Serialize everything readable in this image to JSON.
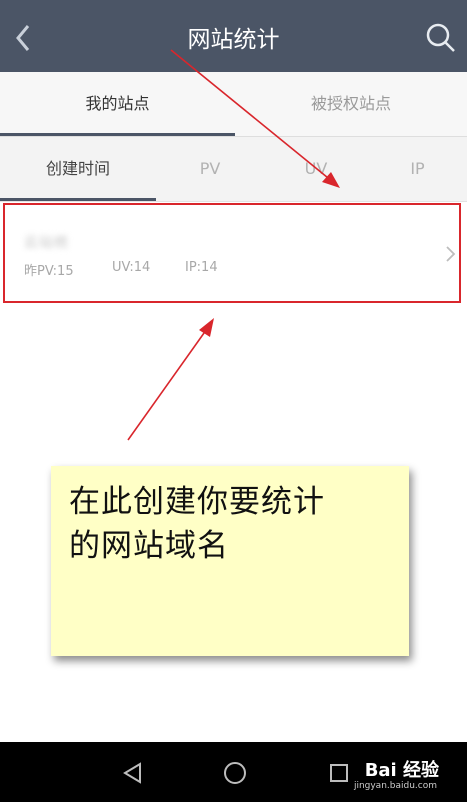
{
  "header": {
    "title": "网站统计",
    "back_icon": "chevron-left-icon",
    "search_icon": "search-icon"
  },
  "main_tabs": [
    {
      "label": "我的站点",
      "active": true
    },
    {
      "label": "被授权站点",
      "active": false
    }
  ],
  "sort_tabs": [
    {
      "label": "创建时间",
      "active": true
    },
    {
      "label": "PV",
      "active": false
    },
    {
      "label": "UV",
      "active": false
    },
    {
      "label": "IP",
      "active": false
    }
  ],
  "site": {
    "name": "云站统",
    "stats": [
      "昨PV:15",
      "UV:14",
      "IP:14"
    ]
  },
  "annotation": {
    "note_line1": "在此创建你要统计",
    "note_line2": "的网站域名"
  },
  "watermark": {
    "brand": "Bai 经验",
    "url": "jingyan.baidu.com"
  },
  "colors": {
    "header_bg": "#4b5566",
    "annotation_red": "#d9262c",
    "note_bg": "#ffffc6"
  }
}
